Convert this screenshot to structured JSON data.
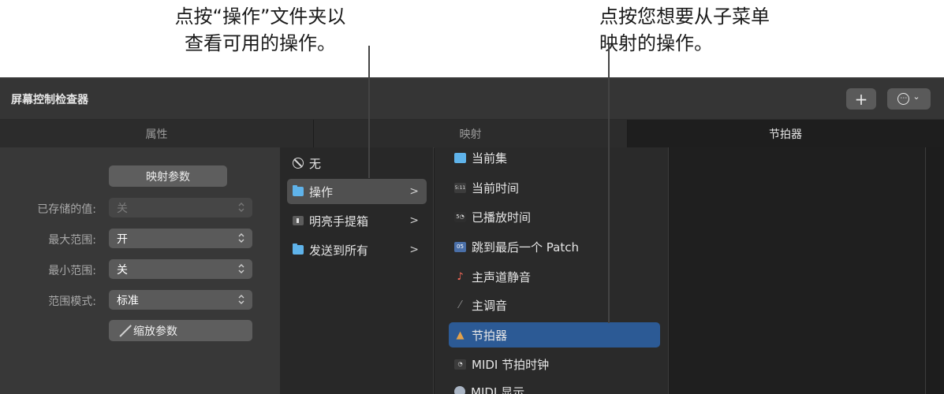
{
  "callouts": {
    "left_line1": "点按“操作”文件夹以",
    "left_line2": "查看可用的操作。",
    "right_line1": "点按您想要从子菜单",
    "right_line2": "映射的操作。"
  },
  "window": {
    "title": "屏幕控制检查器",
    "add_label": "+",
    "more_label": "⋯",
    "more_chevron": "⌄"
  },
  "tabs": [
    {
      "label": "属性"
    },
    {
      "label": "映射"
    },
    {
      "label": "节拍器"
    }
  ],
  "inspector": {
    "map_params_label": "映射参数",
    "scale_params_label": "缩放参数",
    "rows": [
      {
        "label": "已存储的值:",
        "value": "关",
        "enabled": false
      },
      {
        "label": "最大范围:",
        "value": "开",
        "enabled": true
      },
      {
        "label": "最小范围:",
        "value": "关",
        "enabled": true
      },
      {
        "label": "范围模式:",
        "value": "标准",
        "enabled": true
      }
    ]
  },
  "mapping_col1": [
    {
      "label": "无",
      "icon": "none-icon"
    },
    {
      "label": "操作",
      "icon": "folder-icon",
      "has_submenu": true,
      "highlighted": true
    },
    {
      "label": "明亮手提箱",
      "icon": "screenset-icon",
      "has_submenu": true
    },
    {
      "label": "发送到所有",
      "icon": "folder-icon",
      "has_submenu": true
    }
  ],
  "submenu_chevron": ">",
  "mapping_col2": [
    {
      "label": "当前集",
      "icon": "folder-icon",
      "glyph": ""
    },
    {
      "label": "当前时间",
      "icon": "time-icon",
      "glyph": "5:11"
    },
    {
      "label": "已播放时间",
      "icon": "played-time-icon",
      "glyph": "5◔"
    },
    {
      "label": "跳到最后一个 Patch",
      "icon": "patch-icon",
      "glyph": "05"
    },
    {
      "label": "主声道静音",
      "icon": "master-mute-icon",
      "glyph": "♪"
    },
    {
      "label": "主调音",
      "icon": "tuning-icon",
      "glyph": "⁄"
    },
    {
      "label": "节拍器",
      "icon": "metronome-icon",
      "glyph": "▲",
      "selected": true
    },
    {
      "label": "MIDI 节拍时钟",
      "icon": "midi-clock-icon",
      "glyph": "◔"
    },
    {
      "label": "MIDI 显示",
      "icon": "midi-display-icon",
      "glyph": ""
    }
  ],
  "colors": {
    "selection": "#2c5a95",
    "folder": "#5fb3ea",
    "panel_bg": "#1e1e1e"
  }
}
